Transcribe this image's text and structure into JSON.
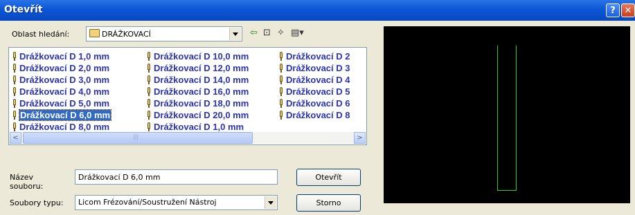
{
  "window": {
    "title": "Otevřít"
  },
  "title_buttons": {
    "help": "?",
    "close": "✕"
  },
  "look_in": {
    "label": "Oblast hledání:",
    "value": "DRÁŽKOVACÍ"
  },
  "toolbar": {
    "back": "⇦",
    "up": "⊡",
    "new_folder": "✧",
    "views": "▤▾"
  },
  "files": [
    [
      "Drážkovací D 1,0 mm",
      "Drážkovací D 2,0 mm",
      "Drážkovací D 3,0 mm",
      "Drážkovací D 4,0 mm",
      "Drážkovací D 5,0 mm",
      "Drážkovací D 6,0 mm",
      "Drážkovací D 8,0 mm"
    ],
    [
      "Drážkovací D 10,0 mm",
      "Drážkovací D 12,0 mm",
      "Drážkovací D 14,0 mm",
      "Drážkovací D 16,0 mm",
      "Drážkovací D 18,0 mm",
      "Drážkovací D 20,0 mm",
      "Drážkovací D  1,0 mm"
    ],
    [
      "Drážkovací D  2",
      "Drážkovací D  3",
      "Drážkovací D  4",
      "Drážkovací D  5",
      "Drážkovací D  6",
      "Drážkovací D  8"
    ]
  ],
  "selected_file": "Drážkovací D 6,0 mm",
  "scrollbar": {
    "left": "<",
    "right": ">"
  },
  "filename": {
    "label_line1": "Název",
    "label_line2": "souboru:",
    "value": "Drážkovací D 6,0 mm"
  },
  "filetype": {
    "label": "Soubory typu:",
    "value": "Licom Frézování/Soustružení Nástroj"
  },
  "buttons": {
    "open": "Otevřít",
    "cancel": "Storno"
  },
  "preview": {
    "background": "#000000",
    "line_color": "#19d419"
  }
}
